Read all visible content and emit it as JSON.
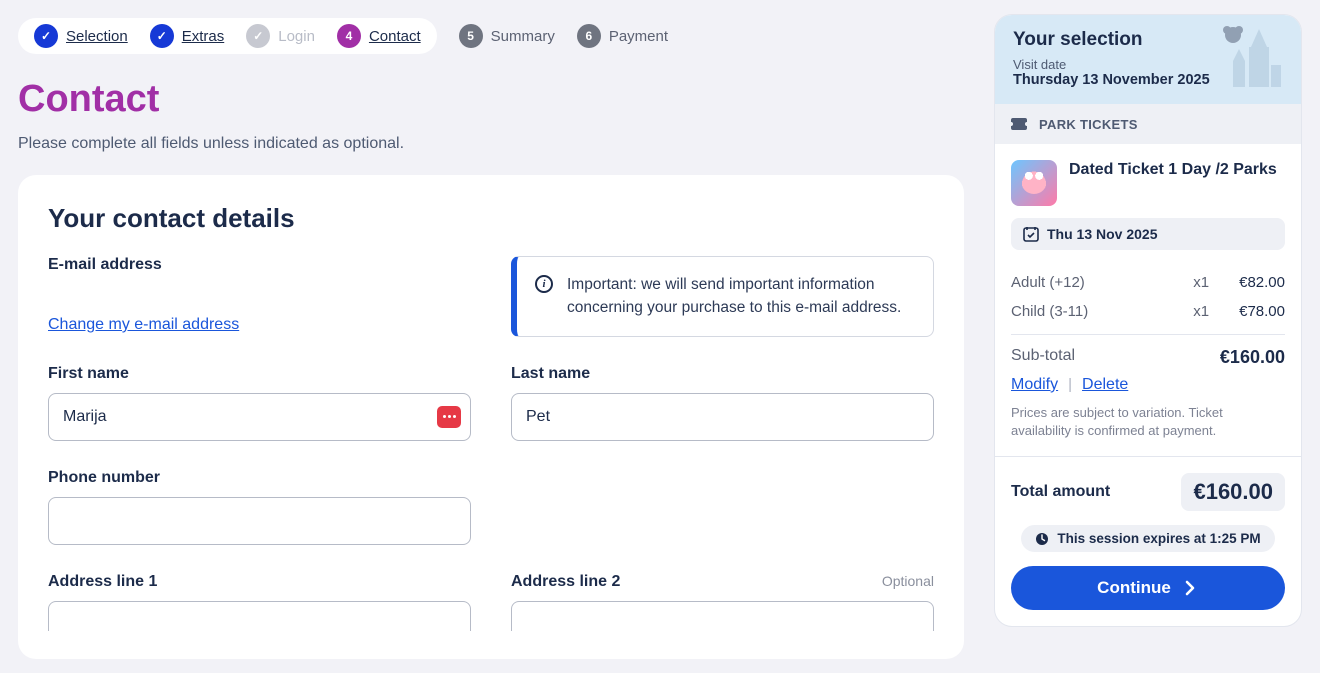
{
  "steps": [
    {
      "label": "Selection",
      "state": "done",
      "num": ""
    },
    {
      "label": "Extras",
      "state": "done",
      "num": ""
    },
    {
      "label": "Login",
      "state": "disabled",
      "num": ""
    },
    {
      "label": "Contact",
      "state": "current",
      "num": "4"
    },
    {
      "label": "Summary",
      "state": "future",
      "num": "5"
    },
    {
      "label": "Payment",
      "state": "future",
      "num": "6"
    }
  ],
  "page": {
    "title": "Contact",
    "subtitle": "Please complete all fields unless indicated as optional."
  },
  "contact": {
    "heading": "Your contact details",
    "email_label": "E-mail address",
    "change_email": "Change my e-mail address",
    "info_text": "Important: we will send important information concerning your purchase to this e-mail address.",
    "first_name_label": "First name",
    "first_name_value": "Marija",
    "last_name_label": "Last name",
    "last_name_value": "Pet",
    "phone_label": "Phone number",
    "phone_value": "",
    "addr1_label": "Address line 1",
    "addr2_label": "Address line 2",
    "optional_tag": "Optional"
  },
  "basket": {
    "heading": "Your selection",
    "visit_date_label": "Visit date",
    "visit_date_value": "Thursday 13 November 2025",
    "section": "PARK TICKETS",
    "product_name": "Dated Ticket 1 Day /2 Parks",
    "product_date": "Thu 13 Nov 2025",
    "lines": [
      {
        "label": "Adult (+12)",
        "qty": "x1",
        "amount": "€82.00"
      },
      {
        "label": "Child (3-11)",
        "qty": "x1",
        "amount": "€78.00"
      }
    ],
    "subtotal_label": "Sub-total",
    "subtotal_value": "€160.00",
    "modify": "Modify",
    "delete": "Delete",
    "disclaimer": "Prices are subject to variation. Ticket availability is confirmed at payment.",
    "total_label": "Total amount",
    "total_value": "€160.00",
    "session_text": "This session expires at 1:25 PM",
    "continue": "Continue"
  }
}
